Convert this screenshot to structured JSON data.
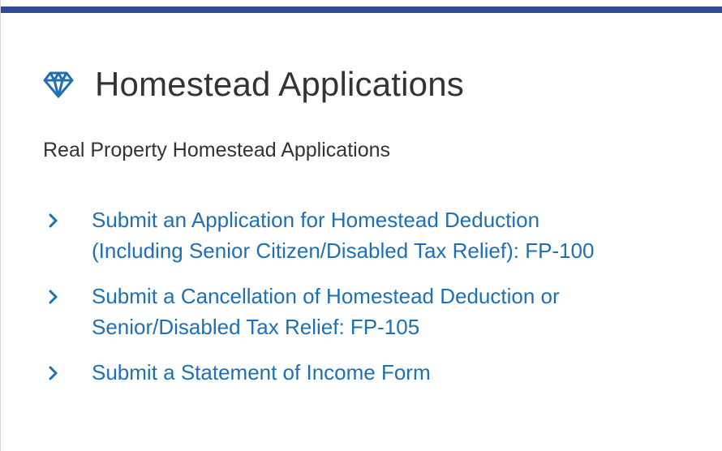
{
  "panel": {
    "title": "Homestead Applications",
    "subtitle": "Real Property Homestead Applications",
    "icon": "diamond-icon",
    "colors": {
      "accent_bar": "#2e4b93",
      "icon": "#1f6fb4",
      "link": "#1f6fb4",
      "text": "#333333"
    }
  },
  "links": [
    {
      "lines": [
        "Submit an Application for Homestead Deduction",
        "(Including Senior Citizen/Disabled Tax Relief): FP-100"
      ],
      "icon": "chevron-right-icon"
    },
    {
      "lines": [
        "Submit a Cancellation of Homestead Deduction or",
        "Senior/Disabled Tax Relief: FP-105"
      ],
      "icon": "chevron-right-icon"
    },
    {
      "lines": [
        "Submit a Statement of Income Form"
      ],
      "icon": "chevron-right-icon"
    }
  ]
}
